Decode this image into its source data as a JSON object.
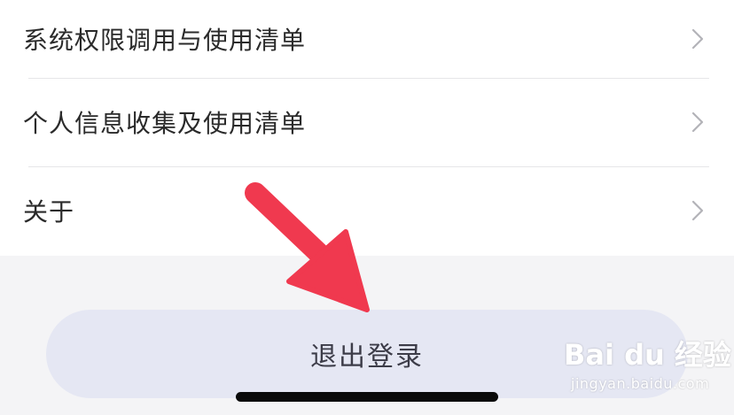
{
  "settings_list": {
    "items": [
      {
        "label": "系统权限调用与使用清单"
      },
      {
        "label": "个人信息收集及使用清单"
      },
      {
        "label": "关于"
      }
    ]
  },
  "logout_button": {
    "label": "退出登录"
  },
  "watermark": {
    "logo": "Bai du 经验",
    "url": "jingyan.baidu.com"
  },
  "colors": {
    "page_background": "#f4f4f6",
    "list_background": "#ffffff",
    "logout_button_background": "#e5e7f3",
    "annotation_arrow": "#f0394f"
  },
  "icons": [
    "chevron-right-icon",
    "annotation-arrow-icon",
    "home-indicator"
  ]
}
